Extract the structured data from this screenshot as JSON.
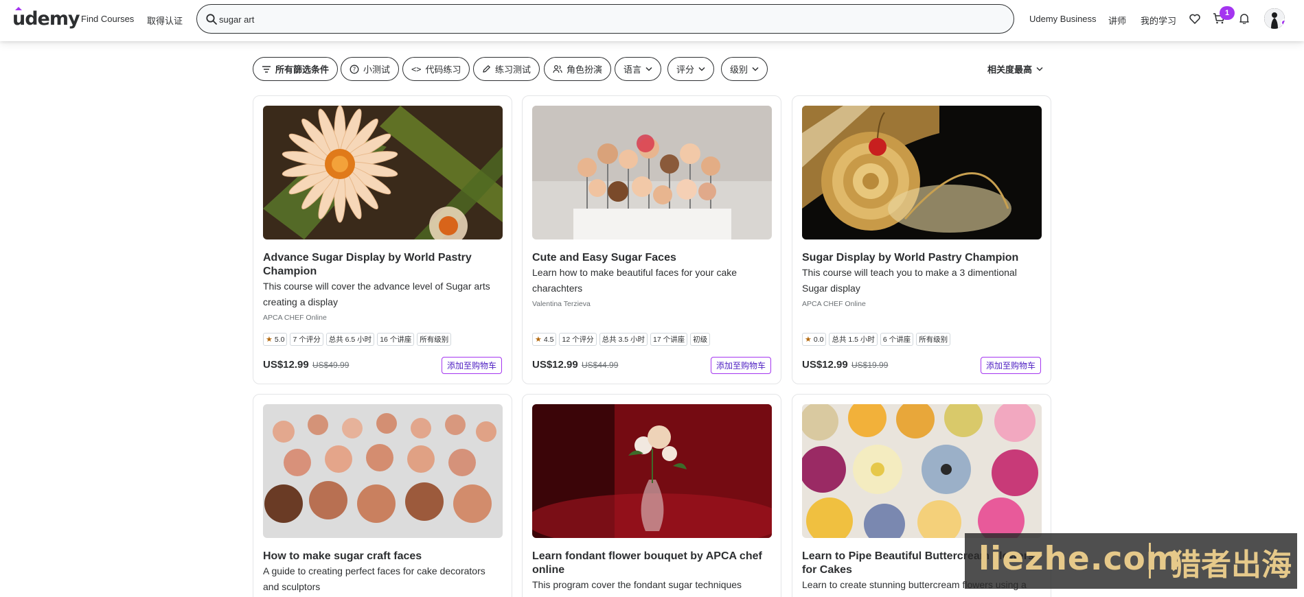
{
  "header": {
    "logo": "udemy",
    "find_courses": "Find Courses",
    "certify": "取得认证",
    "search_value": "sugar art",
    "udemy_business": "Udemy Business",
    "instructor": "讲师",
    "my_learning": "我的学习",
    "cart_count": "1"
  },
  "filters": {
    "all": "所有篩选条件",
    "quiz": "小测试",
    "coding": "代码练习",
    "practice": "练习测试",
    "roleplay": "角色扮演",
    "language": "语言",
    "rating": "评分",
    "level": "级别",
    "sort": "相关度最高"
  },
  "courses": [
    {
      "title": "Advance Sugar Display by World Pastry Champion",
      "description": "This course will cover the advance level of Sugar arts creating a display",
      "instructor": "APCA CHEF Online",
      "rating": "5.0",
      "reviews": "7 个评分",
      "hours": "总共 6.5 小时",
      "lectures": "16 个讲座",
      "level": "所有级别",
      "price": "US$12.99",
      "original_price": "US$49.99",
      "add_to_cart": "添加至购物车"
    },
    {
      "title": "Cute and Easy Sugar Faces",
      "description": "Learn how to make beautiful faces for your cake charachters",
      "instructor": "Valentina Terzieva",
      "rating": "4.5",
      "reviews": "12 个评分",
      "hours": "总共 3.5 小时",
      "lectures": "17 个讲座",
      "level": "初级",
      "price": "US$12.99",
      "original_price": "US$44.99",
      "add_to_cart": "添加至购物车"
    },
    {
      "title": "Sugar Display by World Pastry Champion",
      "description": "This course will teach you to make a 3 dimentional Sugar display",
      "instructor": "APCA CHEF Online",
      "rating": "0.0",
      "hours": "总共 1.5 小时",
      "lectures": "6 个讲座",
      "level": "所有级别",
      "price": "US$12.99",
      "original_price": "US$19.99",
      "add_to_cart": "添加至购物车"
    },
    {
      "title": "How to make sugar craft faces",
      "description": "A guide to creating perfect faces for cake decorators and sculptors"
    },
    {
      "title": "Learn fondant flower bouquet by APCA chef online",
      "description": "This program cover the fondant sugar techniques"
    },
    {
      "title": "Learn to Pipe Beautiful Buttercream Flowers for Cakes",
      "description": "Learn to create stunning buttercream flowers using a"
    }
  ],
  "watermark": {
    "domain": "liezhe.com",
    "name": "猎者出海"
  }
}
